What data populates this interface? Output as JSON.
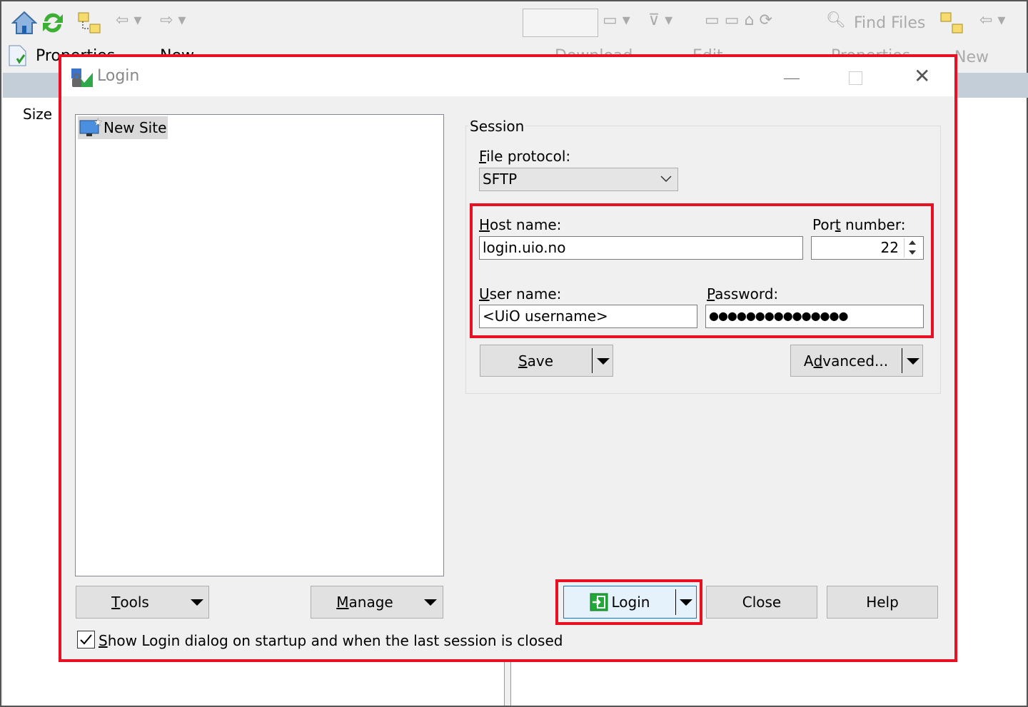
{
  "background": {
    "toolbar": {
      "find_files": "Find Files",
      "properties_left": "Properties",
      "new_left": "New",
      "download": "Download",
      "edit": "Edit",
      "properties_right": "Properties",
      "new_right": "New"
    },
    "column_size": "Size"
  },
  "dialog": {
    "title": "Login",
    "site_tree": {
      "items": [
        {
          "label": "New Site",
          "icon": "monitor-new-site-icon"
        }
      ]
    },
    "session": {
      "group_label": "Session",
      "file_protocol": {
        "pre": "",
        "key": "F",
        "post": "ile protocol:",
        "value": "SFTP"
      },
      "host_name": {
        "pre": "",
        "key": "H",
        "post": "ost name:",
        "value": "login.uio.no"
      },
      "port_number": {
        "pre": "Por",
        "key": "t",
        "post": " number:",
        "value": "22"
      },
      "user_name": {
        "pre": "",
        "key": "U",
        "post": "ser name:",
        "value": "<UiO username>"
      },
      "password": {
        "pre": "",
        "key": "P",
        "post": "assword:",
        "value": "●●●●●●●●●●●●●●●"
      },
      "save": {
        "pre": "",
        "key": "S",
        "post": "ave"
      },
      "advanced": {
        "pre": "A",
        "key": "d",
        "post": "vanced..."
      }
    },
    "buttons": {
      "tools": {
        "pre": "",
        "key": "T",
        "post": "ools"
      },
      "manage": {
        "pre": "",
        "key": "M",
        "post": "anage"
      },
      "login": "Login",
      "close": "Close",
      "help": "Help"
    },
    "startup_checkbox": {
      "pre": "",
      "key": "S",
      "post": "how Login dialog on startup and when the last session is closed",
      "checked": true
    }
  },
  "colors": {
    "highlight": "#e81123",
    "title_text": "#888888",
    "login_icon": "#22a838"
  }
}
